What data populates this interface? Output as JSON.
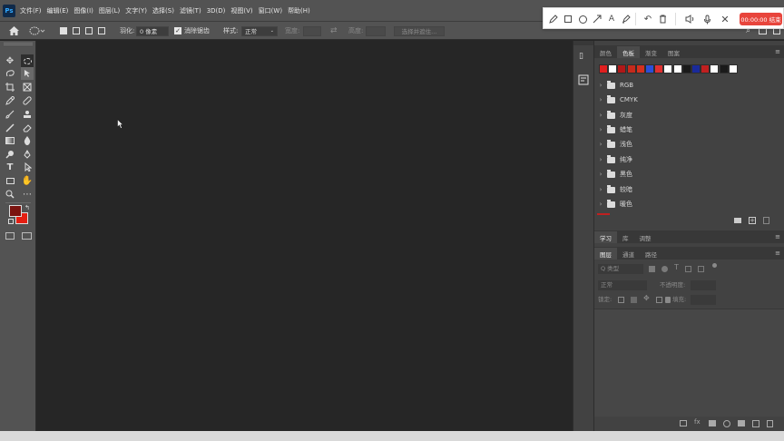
{
  "app": {
    "logo": "Ps"
  },
  "menu": [
    "文件(F)",
    "编辑(E)",
    "图像(I)",
    "图层(L)",
    "文字(Y)",
    "选择(S)",
    "滤镜(T)",
    "3D(D)",
    "视图(V)",
    "窗口(W)",
    "帮助(H)"
  ],
  "options": {
    "feather_label": "羽化:",
    "feather_value": "0 像素",
    "antialias_label": "消除锯齿",
    "style_label": "样式:",
    "style_value": "正常",
    "width_label": "宽度:",
    "height_label": "高度:",
    "select_mask_label": "选择并遮住..."
  },
  "recorder": {
    "timer": "00:00:00 结束"
  },
  "swatches_panel": {
    "tabs": [
      "颜色",
      "色板",
      "渐变",
      "图案"
    ],
    "active_tab": 1,
    "colors": [
      "#e02020",
      "#ffffff",
      "#b01818",
      "#c62a1c",
      "#d4301e",
      "#2b4fd8",
      "#e03030",
      "#ffffff",
      "#ffffff",
      "#1a1a1a",
      "#1a2a9a",
      "#c02020",
      "#ffffff",
      "#1a1a1a",
      "#ffffff"
    ],
    "groups": [
      "RGB",
      "CMYK",
      "灰度",
      "蜡笔",
      "浅色",
      "纯净",
      "黑色",
      "较暗",
      "暖色"
    ]
  },
  "learn_panel": {
    "tabs": [
      "学习",
      "库",
      "调整"
    ],
    "active_tab": 0
  },
  "layers_panel": {
    "tabs": [
      "图层",
      "通道",
      "路径"
    ],
    "active_tab": 0,
    "search_placeholder": "Q 类型",
    "blend_mode": "正常",
    "opacity_label": "不透明度:",
    "lock_label": "锁定:",
    "fill_label": "填充:"
  },
  "colors": {
    "foreground": "#7a1410",
    "background": "#e41e12",
    "accent": "#31a8ff",
    "timer": "#e8453c"
  }
}
